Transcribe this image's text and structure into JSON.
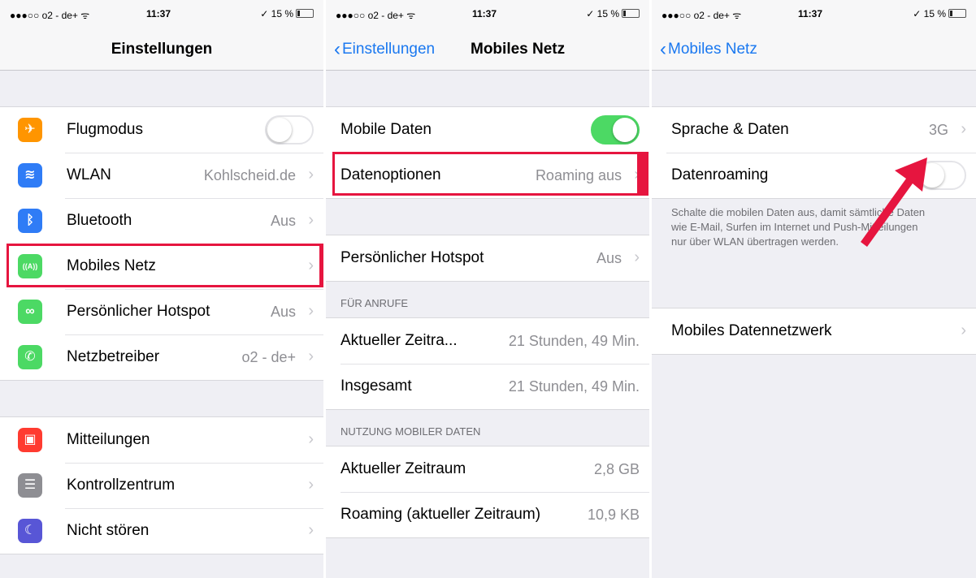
{
  "status": {
    "carrier": "●●●○○ o2 - de+ ᯤ",
    "time": "11:37",
    "battery": "✓ 15 %"
  },
  "panel1": {
    "title": "Einstellungen",
    "group1": [
      {
        "label": "Flugmodus",
        "icon": "airplane-icon",
        "icon_glyph": "✈",
        "color": "#ff9500",
        "toggle": false
      },
      {
        "label": "WLAN",
        "value": "Kohlscheid.de",
        "icon": "wifi-icon",
        "icon_glyph": "≋",
        "color": "#2f7cf6"
      },
      {
        "label": "Bluetooth",
        "value": "Aus",
        "icon": "bluetooth-icon",
        "icon_glyph": "ᛒ",
        "color": "#2f7cf6"
      },
      {
        "label": "Mobiles Netz",
        "value": "",
        "icon": "cellular-antenna-icon",
        "icon_glyph": "((A))",
        "color": "#4cd964"
      },
      {
        "label": "Persönlicher Hotspot",
        "value": "Aus",
        "icon": "hotspot-icon",
        "icon_glyph": "∞",
        "color": "#4cd964"
      },
      {
        "label": "Netzbetreiber",
        "value": "o2 - de+",
        "icon": "phone-icon",
        "icon_glyph": "✆",
        "color": "#4cd964"
      }
    ],
    "group2": [
      {
        "label": "Mitteilungen",
        "icon": "notifications-icon",
        "icon_glyph": "▣",
        "color": "#ff3b30"
      },
      {
        "label": "Kontrollzentrum",
        "icon": "control-center-icon",
        "icon_glyph": "☰",
        "color": "#8e8e93"
      },
      {
        "label": "Nicht stören",
        "icon": "moon-icon",
        "icon_glyph": "☾",
        "color": "#5856d6"
      }
    ]
  },
  "panel2": {
    "back": "Einstellungen",
    "title": "Mobiles Netz",
    "mobile_data_label": "Mobile Daten",
    "mobile_data_on": true,
    "data_options_label": "Datenoptionen",
    "data_options_value": "Roaming aus",
    "hotspot_label": "Persönlicher Hotspot",
    "hotspot_value": "Aus",
    "calls_header": "FÜR ANRUFE",
    "calls_rows": [
      {
        "label": "Aktueller Zeitra...",
        "value": "21 Stunden, 49 Min."
      },
      {
        "label": "Insgesamt",
        "value": "21 Stunden, 49 Min."
      }
    ],
    "usage_header": "NUTZUNG MOBILER DATEN",
    "usage_rows": [
      {
        "label": "Aktueller Zeitraum",
        "value": "2,8 GB"
      },
      {
        "label": "Roaming (aktueller Zeitraum)",
        "value": "10,9 KB"
      }
    ]
  },
  "panel3": {
    "back": "Mobiles Netz",
    "voice_label": "Sprache & Daten",
    "voice_value": "3G",
    "roaming_label": "Datenroaming",
    "roaming_on": false,
    "footer": "Schalte die mobilen Daten aus, damit sämtliche Daten wie E-Mail, Surfen im Internet und Push-Mitteilungen nur über WLAN übertragen werden.",
    "network_label": "Mobiles Datennetzwerk"
  },
  "colors": {
    "accent": "#1a78f0",
    "highlight": "#e6153f",
    "toggle_on": "#4cd964"
  }
}
